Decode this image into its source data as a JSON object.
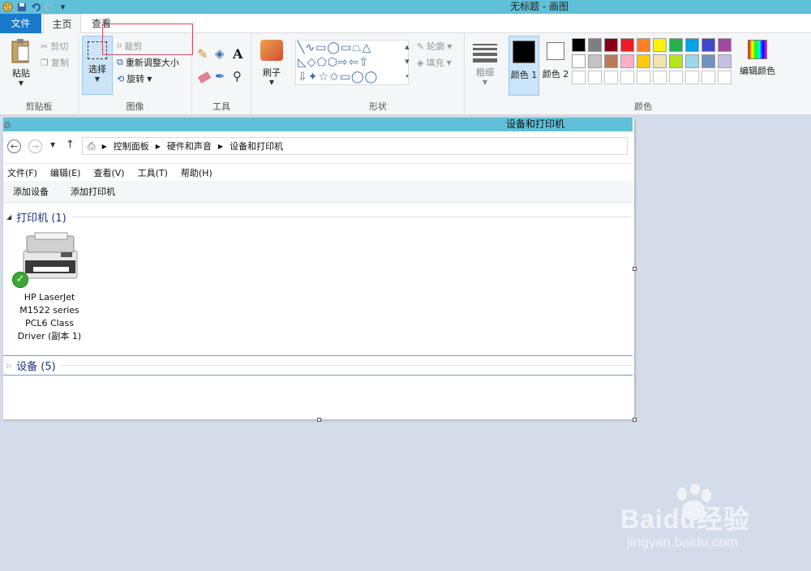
{
  "window": {
    "title": "无标题 - 画图"
  },
  "tabs": {
    "file": "文件",
    "home": "主页",
    "view": "查看"
  },
  "clipboard": {
    "paste": "粘贴",
    "cut": "剪切",
    "copy": "复制",
    "group": "剪贴板"
  },
  "image": {
    "select": "选择",
    "crop": "裁剪",
    "resize": "重新调整大小",
    "rotate": "旋转",
    "group": "图像"
  },
  "tools": {
    "group": "工具"
  },
  "brushes": {
    "label": "刷子"
  },
  "shapes": {
    "outline": "轮廓",
    "fill": "填充",
    "group": "形状"
  },
  "size": {
    "label": "粗细"
  },
  "colors": {
    "color1": "颜色 1",
    "color2": "颜色 2",
    "edit": "编辑颜色",
    "group": "颜色",
    "palette_row1": [
      "#000000",
      "#7f7f7f",
      "#880015",
      "#ed1c24",
      "#ff7f27",
      "#fff200",
      "#22b14c",
      "#00a2e8",
      "#3f48cc",
      "#a349a4"
    ],
    "palette_row2": [
      "#ffffff",
      "#c3c3c3",
      "#b97a57",
      "#ffaec9",
      "#ffc90e",
      "#efe4b0",
      "#b5e61d",
      "#99d9ea",
      "#7092be",
      "#c8bfe7"
    ]
  },
  "explorer": {
    "title": "设备和打印机",
    "breadcrumb": [
      "控制面板",
      "硬件和声音",
      "设备和打印机"
    ],
    "menu": [
      "文件(F)",
      "编辑(E)",
      "查看(V)",
      "工具(T)",
      "帮助(H)"
    ],
    "commands": [
      "添加设备",
      "添加打印机"
    ],
    "printers_section": "打印机 (1)",
    "printer_name": [
      "HP LaserJet",
      "M1522 series",
      "PCL6 Class",
      "Driver (副本 1)"
    ],
    "devices_section": "设备 (5)"
  },
  "watermark": {
    "brand": "Baidu经验",
    "url": "jingyan.baidu.com"
  }
}
